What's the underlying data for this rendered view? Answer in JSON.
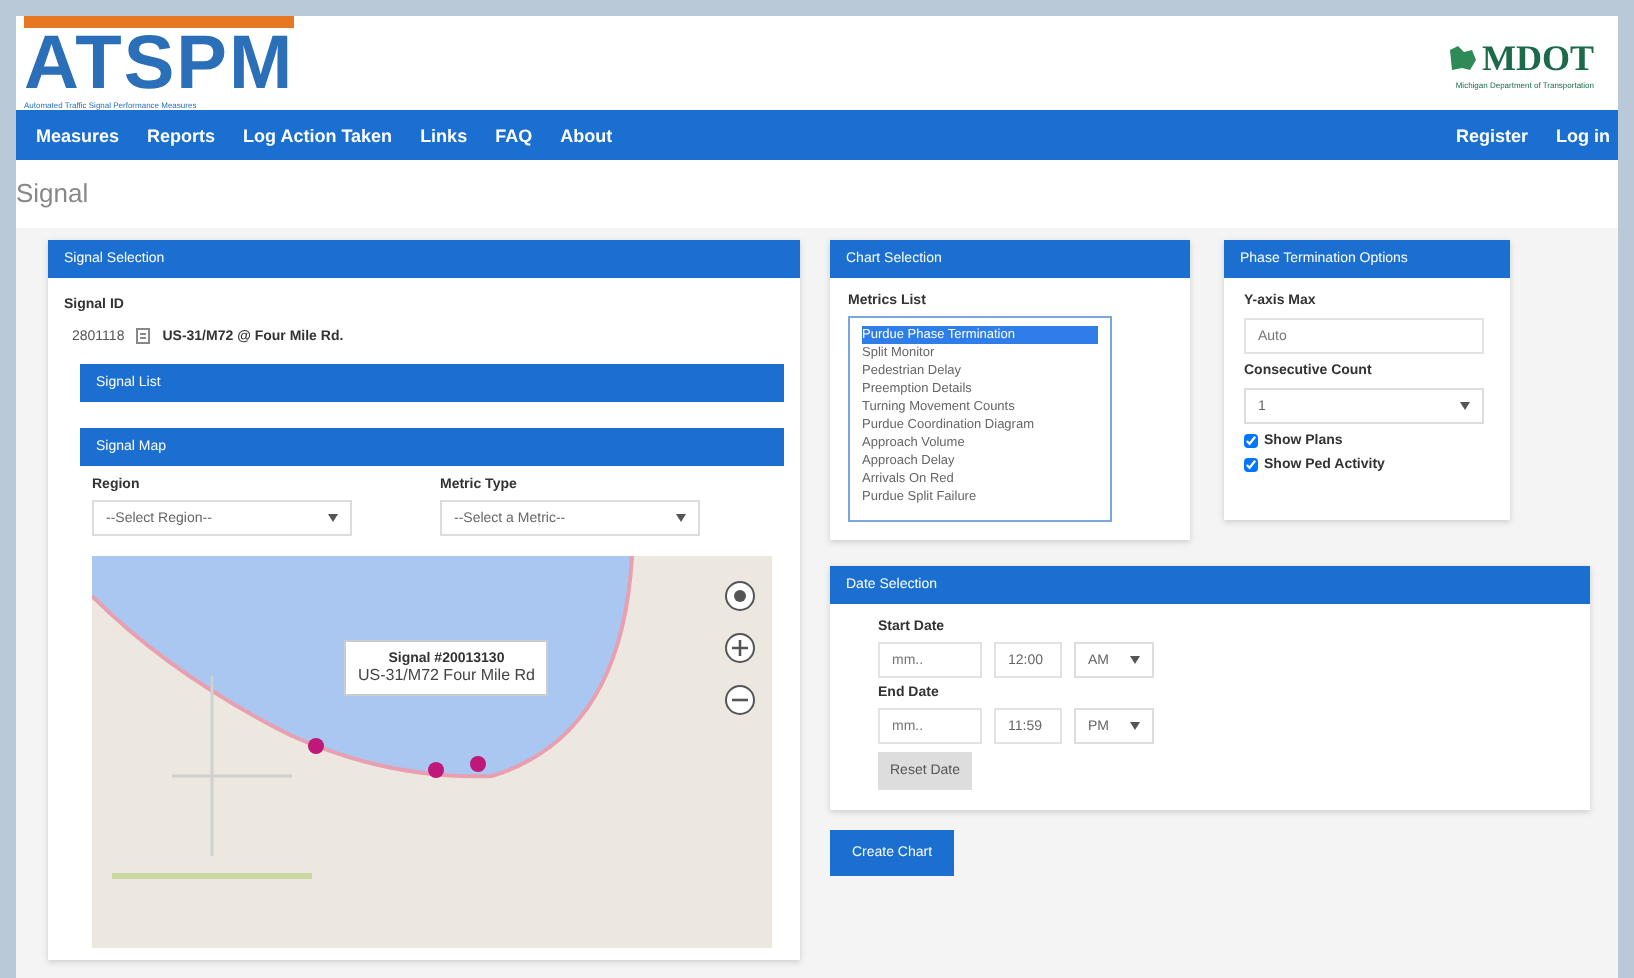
{
  "logo": {
    "text": "ATSPM",
    "subtitle": "Automated Traffic Signal Performance Measures"
  },
  "partner_logo": {
    "text": "MDOT",
    "subtitle": "Michigan Department of Transportation"
  },
  "nav": {
    "left": [
      "Measures",
      "Reports",
      "Log Action Taken",
      "Links",
      "FAQ",
      "About"
    ],
    "right": [
      "Register",
      "Log in"
    ]
  },
  "page_title": "Signal",
  "signal_selection": {
    "title": "Signal Selection",
    "signal_id_label": "Signal ID",
    "signal_id": "2801118",
    "signal_name": "US-31/M72 @ Four Mile Rd.",
    "signal_list_title": "Signal List",
    "signal_map_title": "Signal Map",
    "region": {
      "label": "Region",
      "value": "--Select Region--"
    },
    "metric_type": {
      "label": "Metric Type",
      "value": "--Select a Metric--"
    },
    "map": {
      "kind": "picture",
      "popup": {
        "title": "Signal #20013130",
        "text": "US-31/M72 Four Mile Rd"
      }
    }
  },
  "chart_selection": {
    "title": "Chart Selection",
    "label": "Metrics List",
    "items": [
      {
        "label": "Purdue Phase Termination",
        "selected": true
      },
      {
        "label": "Split Monitor",
        "selected": false
      },
      {
        "label": "Pedestrian Delay",
        "selected": false
      },
      {
        "label": "Preemption Details",
        "selected": false
      },
      {
        "label": "Turning Movement Counts",
        "selected": false
      },
      {
        "label": "Purdue Coordination Diagram",
        "selected": false
      },
      {
        "label": "Approach Volume",
        "selected": false
      },
      {
        "label": "Approach Delay",
        "selected": false
      },
      {
        "label": "Arrivals On Red",
        "selected": false
      },
      {
        "label": "Purdue Split Failure",
        "selected": false
      }
    ]
  },
  "options": {
    "title": "Phase Termination Options",
    "y_axis_label": "Y-axis Max",
    "y_axis_placeholder": "Auto",
    "count_label": "Consecutive Count",
    "count_value": "1",
    "checks": [
      {
        "label": "Show Plans",
        "checked": true
      },
      {
        "label": "Show Ped Activity",
        "checked": true
      }
    ]
  },
  "date_selection": {
    "title": "Date Selection",
    "rows": [
      {
        "label": "Start Date",
        "date_placeholder": "mm..",
        "time": "12:00",
        "ampm": "AM"
      },
      {
        "label": "End Date",
        "date_placeholder": "mm..",
        "time": "11:59",
        "ampm": "PM"
      }
    ],
    "reset": "Reset Date"
  },
  "create_button": "Create Chart"
}
